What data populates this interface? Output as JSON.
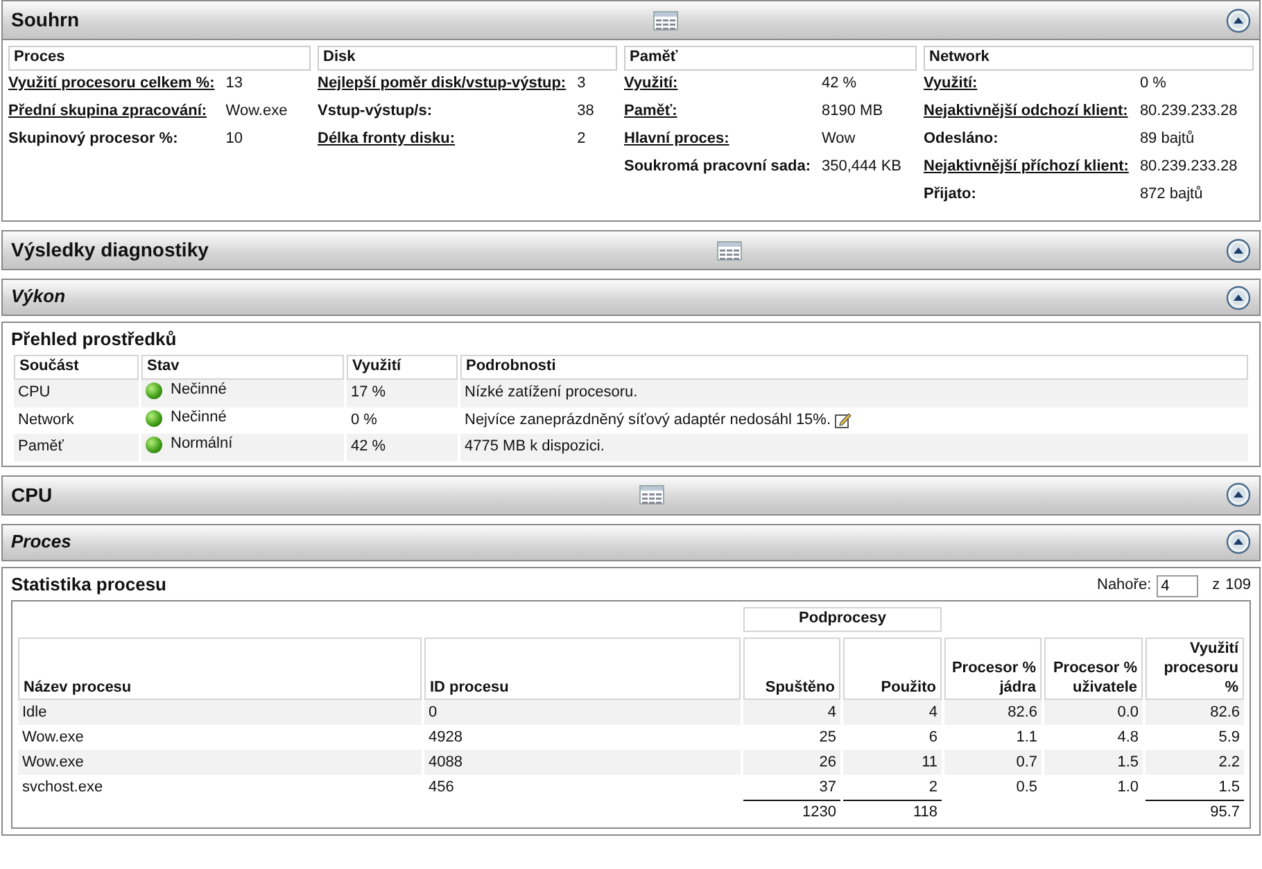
{
  "panels": [
    {
      "kind": "main",
      "title": "Souhrn",
      "summary": [
        {
          "title": "Proces",
          "rows": [
            {
              "label": "Využití procesoru celkem %:",
              "value": "13",
              "link": true
            },
            {
              "label": "Přední skupina zpracování:",
              "value": "Wow.exe",
              "link": true
            },
            {
              "label": "Skupinový procesor %:",
              "value": "10",
              "link": false
            }
          ]
        },
        {
          "title": "Disk",
          "rows": [
            {
              "label": "Nejlepší poměr disk/vstup-výstup:",
              "value": "3",
              "link": true
            },
            {
              "label": "Vstup-výstup/s:",
              "value": "38",
              "link": false
            },
            {
              "label": "Délka fronty disku:",
              "value": "2",
              "link": true
            }
          ]
        },
        {
          "title": "Paměť",
          "rows": [
            {
              "label": "Využití:",
              "value": "42 %",
              "link": true
            },
            {
              "label": "Paměť:",
              "value": "8190 MB",
              "link": true
            },
            {
              "label": "Hlavní proces:",
              "value": "Wow",
              "link": true
            },
            {
              "label": "Soukromá pracovní sada:",
              "value": "350,444 KB",
              "link": false
            }
          ]
        },
        {
          "title": "Network",
          "rows": [
            {
              "label": "Využití:",
              "value": "0 %",
              "link": true
            },
            {
              "label": "Nejaktivnější odchozí klient:",
              "value": "80.239.233.28",
              "link": true
            },
            {
              "label": "Odesláno:",
              "value": "89 bajtů",
              "link": false
            },
            {
              "label": "Nejaktivnější příchozí klient:",
              "value": "80.239.233.28",
              "link": true
            },
            {
              "label": "Přijato:",
              "value": "872 bajtů",
              "link": false
            }
          ]
        }
      ]
    },
    {
      "kind": "main",
      "title": "Výsledky diagnostiky"
    },
    {
      "kind": "sub",
      "title": "Výkon"
    },
    {
      "kind": "resource_table",
      "title": "Přehled prostředků",
      "columns": [
        "Součást",
        "Stav",
        "Využití",
        "Podrobnosti"
      ],
      "rows": [
        {
          "component": "CPU",
          "status": "Nečinné",
          "usage": "17 %",
          "details": "Nízké zatížení procesoru.",
          "note": false
        },
        {
          "component": "Network",
          "status": "Nečinné",
          "usage": "0 %",
          "details": "Nejvíce zaneprázdněný síťový adaptér nedosáhl 15%.",
          "note": true
        },
        {
          "component": "Paměť",
          "status": "Normální",
          "usage": "42 %",
          "details": "4775 MB k dispozici.",
          "note": false
        }
      ]
    },
    {
      "kind": "main",
      "title": "CPU"
    },
    {
      "kind": "sub",
      "title": "Proces"
    },
    {
      "kind": "process_table",
      "title": "Statistika procesu",
      "top_label": "Nahoře:",
      "top_value": "4",
      "of_label": "z",
      "of_total": "109",
      "group_label": "Podprocesy",
      "columns": [
        {
          "label": "Název procesu"
        },
        {
          "label": "ID procesu"
        },
        {
          "label": "Spuštěno",
          "total": "1230"
        },
        {
          "label": "Použito",
          "total": "118"
        },
        {
          "label": "Procesor % jádra"
        },
        {
          "label": "Procesor % uživatele"
        },
        {
          "label": "Využití procesoru %",
          "total": "95.7"
        }
      ],
      "rows": [
        [
          "Idle",
          "0",
          "4",
          "4",
          "82.6",
          "0.0",
          "82.6"
        ],
        [
          "Wow.exe",
          "4928",
          "25",
          "6",
          "1.1",
          "4.8",
          "5.9"
        ],
        [
          "Wow.exe",
          "4088",
          "26",
          "11",
          "0.7",
          "1.5",
          "2.2"
        ],
        [
          "svchost.exe",
          "456",
          "37",
          "2",
          "0.5",
          "1.0",
          "1.5"
        ]
      ]
    }
  ]
}
